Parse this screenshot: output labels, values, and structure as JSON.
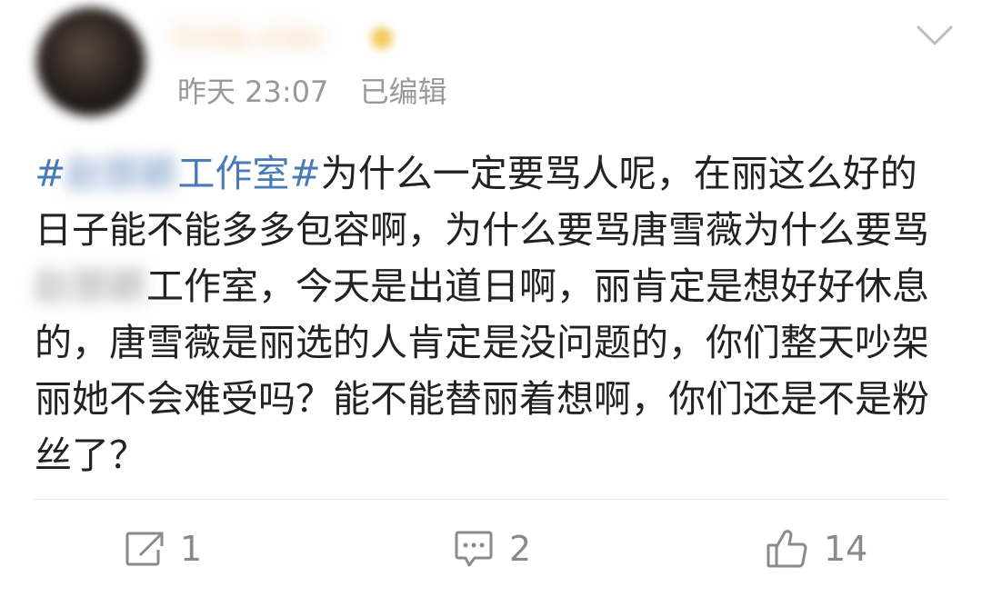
{
  "user": {
    "name": "linda.xiao",
    "time": "昨天 23:07",
    "edited": "已编辑"
  },
  "post": {
    "tag_open": "#",
    "tag_blurred": "赵丽颖",
    "tag_visible": "工作室",
    "tag_close": "#",
    "text_1": "为什么一定要骂人呢，在丽这么好的日子能不能多多包容啊，为什么要骂唐雪薇为什么要骂",
    "mention_blurred": "赵丽颖",
    "text_2": "工作室，今天是出道日啊，丽肯定是想好好休息的，唐雪薇是丽选的人肯定是没问题的，你们整天吵架丽她不会难受吗？能不能替丽着想啊，你们还是不是粉丝了？"
  },
  "actions": {
    "repost_count": "1",
    "comment_count": "2",
    "like_count": "14"
  },
  "icons": {
    "menu": "chevron-down-icon",
    "repost": "share-icon",
    "comment": "comment-icon",
    "like": "thumbs-up-icon"
  },
  "colors": {
    "tag": "#4a7bb7",
    "meta": "#999999",
    "action": "#8a8a8a"
  }
}
